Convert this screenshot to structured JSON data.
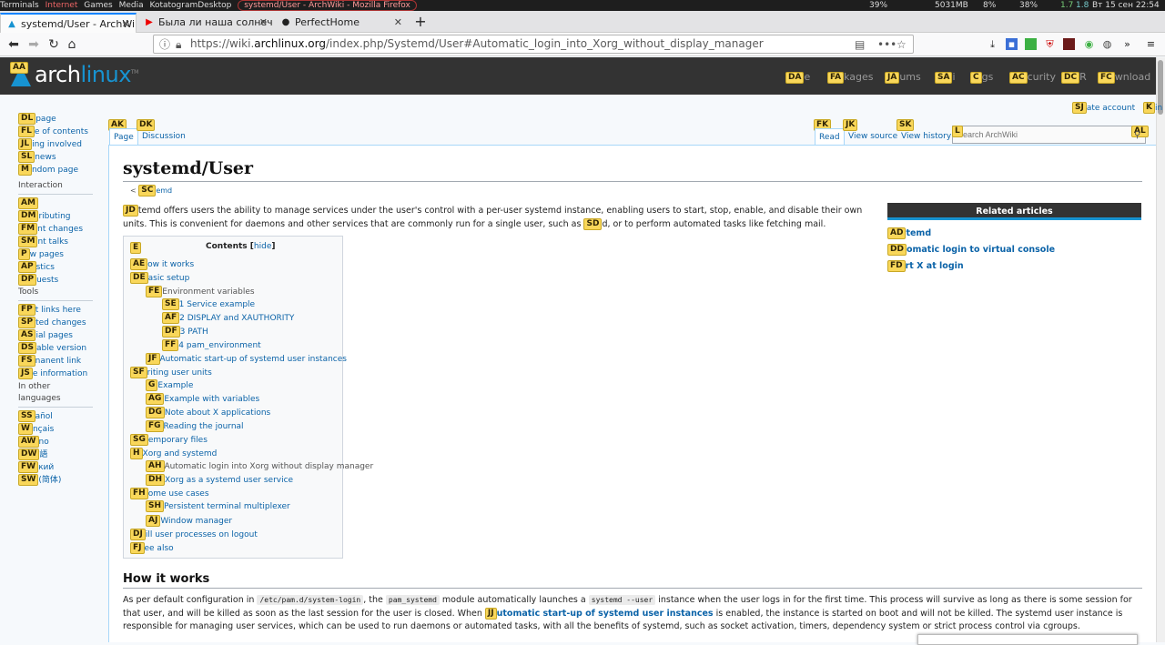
{
  "taskbar": {
    "items": [
      "Terminals",
      "Internet",
      "Games",
      "Media",
      "KotatogramDesktop"
    ],
    "active_window": "systemd/User - ArchWiki - Mozilla Firefox",
    "status": [
      "39%",
      "5031MB",
      "8%",
      "38%",
      "1.7",
      "1.8"
    ],
    "clock": "Вт 15 сен 22:54"
  },
  "browser": {
    "tabs": [
      {
        "label": "systemd/User - ArchWiki",
        "favicon": "arch-icon"
      },
      {
        "label": "Была ли наша солнечная",
        "favicon": "youtube-icon"
      },
      {
        "label": "PerfectHome",
        "favicon": "page-icon"
      }
    ],
    "url_prefix": "https://wiki.",
    "url_domain": "archlinux.org",
    "url_path": "/index.php/Systemd/User#Automatic_login_into_Xorg_without_display_manager",
    "new_tab": "+"
  },
  "site": {
    "logo_arch": "arch",
    "logo_linux": "linux",
    "logo_tm": "TM",
    "logo_hint": "AA",
    "nav": [
      {
        "hint": "DA",
        "label": "e"
      },
      {
        "hint": "FA",
        "label": "kages"
      },
      {
        "hint": "JA",
        "label": "ums"
      },
      {
        "hint": "SA",
        "label": "i"
      },
      {
        "hint": "C",
        "label": "gs"
      },
      {
        "hint": "AC",
        "label": "curity"
      },
      {
        "hint": "DC",
        "label": "R"
      },
      {
        "hint": "FC",
        "label": "wnload"
      }
    ]
  },
  "user_menu": {
    "create_hint": "SJ",
    "create": "ate account",
    "login_hint": "K",
    "login": "in"
  },
  "page_tabs": [
    {
      "hint": "AK",
      "label": "Page"
    },
    {
      "hint": "DK",
      "label": "Discussion"
    },
    {
      "hint": "FK",
      "label": "Read"
    },
    {
      "hint": "JK",
      "label": "View source"
    },
    {
      "hint": "SK",
      "label": "View history"
    }
  ],
  "search": {
    "hint": "L",
    "placeholder": "Search ArchWiki",
    "go_hint": "AL"
  },
  "sidebar": {
    "nav": [
      {
        "hint": "DL",
        "label": "page"
      },
      {
        "hint": "FL",
        "label": "e of contents"
      },
      {
        "hint": "JL",
        "label": "ing involved"
      },
      {
        "hint": "SL",
        "label": "news"
      },
      {
        "hint": "M",
        "label": "ndom page"
      }
    ],
    "interaction_title": "Interaction",
    "interaction": [
      {
        "hint": "AM",
        "label": ""
      },
      {
        "hint": "DM",
        "label": "ributing"
      },
      {
        "hint": "FM",
        "label": "nt changes"
      },
      {
        "hint": "SM",
        "label": "nt talks"
      },
      {
        "hint": "P",
        "label": "w pages"
      },
      {
        "hint": "AP",
        "label": "stics"
      },
      {
        "hint": "DP",
        "label": "uests"
      }
    ],
    "tools_title": "Tools",
    "tools": [
      {
        "hint": "FP",
        "label": "t links here"
      },
      {
        "hint": "SP",
        "label": "ted changes"
      },
      {
        "hint": "AS",
        "label": "ial pages"
      },
      {
        "hint": "DS",
        "label": "able version"
      },
      {
        "hint": "FS",
        "label": "nanent link"
      },
      {
        "hint": "JS",
        "label": "e information"
      }
    ],
    "languages_title": "In other languages",
    "languages": [
      {
        "hint": "SS",
        "label": "añol"
      },
      {
        "hint": "W",
        "label": "nçais"
      },
      {
        "hint": "AW",
        "label": "no"
      },
      {
        "hint": "DW",
        "label": "語"
      },
      {
        "hint": "FW",
        "label": "кий"
      },
      {
        "hint": "SW",
        "label": "(简体)"
      }
    ]
  },
  "article": {
    "title": "systemd/User",
    "crumb_prefix": "<",
    "crumb_hint": "SC",
    "crumb_text": "emd",
    "intro_hint": "JD",
    "intro_1": "temd offers users the ability to manage services under the user's control with a per-user systemd instance, enabling users to start, stop, enable, and disable their own units. This is convenient for daemons and other services that are commonly run for a single user, such as",
    "intro_hint2": "SD",
    "intro_2": "d, or to perform automated tasks like fetching mail.",
    "toc_title": "Contents",
    "toc_hide": "hide",
    "toc_hint": "E",
    "toc": [
      {
        "hint": "AE",
        "label": "ow it works"
      },
      {
        "hint": "DE",
        "label": "asic setup"
      },
      {
        "hint": "FE",
        "label": "Environment variables"
      },
      {
        "hint": "SE",
        "label": "1  Service example"
      },
      {
        "hint": "AF",
        "label": "2  DISPLAY and XAUTHORITY"
      },
      {
        "hint": "DF",
        "label": "3  PATH"
      },
      {
        "hint": "FF",
        "label": "4  pam_environment"
      },
      {
        "hint": "JF",
        "label": "Automatic start-up of systemd user instances"
      },
      {
        "hint": "SF",
        "label": "riting user units"
      },
      {
        "hint": "G",
        "label": "Example"
      },
      {
        "hint": "AG",
        "label": "Example with variables"
      },
      {
        "hint": "DG",
        "label": "Note about X applications"
      },
      {
        "hint": "FG",
        "label": "Reading the journal"
      },
      {
        "hint": "SG",
        "label": "emporary files"
      },
      {
        "hint": "H",
        "label": "Xorg and systemd"
      },
      {
        "hint": "AH",
        "label": "Automatic login into Xorg without display manager"
      },
      {
        "hint": "DH",
        "label": "Xorg as a systemd user service"
      },
      {
        "hint": "FH",
        "label": "ome use cases"
      },
      {
        "hint": "SH",
        "label": "Persistent terminal multiplexer"
      },
      {
        "hint": "AJ",
        "label": "Window manager"
      },
      {
        "hint": "DJ",
        "label": "ill user processes on logout"
      },
      {
        "hint": "FJ",
        "label": "ee also"
      }
    ],
    "related_title": "Related articles",
    "related": [
      {
        "hint": "AD",
        "label": "temd"
      },
      {
        "hint": "DD",
        "label": "omatic login to virtual console"
      },
      {
        "hint": "FD",
        "label": "rt X at login"
      }
    ],
    "section_title": "How it works",
    "para_1": "As per default configuration in",
    "code_1": "/etc/pam.d/system-login",
    "para_2": ", the",
    "code_2": "pam_systemd",
    "para_3": "module automatically launches a",
    "code_3": "systemd --user",
    "para_4": "instance when the user logs in for the first time. This process will survive as long as there is some session for that user, and will be killed as soon as the last session for the user is closed. When",
    "para_hint": "JJ",
    "para_link": "utomatic start-up of systemd user instances",
    "para_5": "is enabled, the instance is started on boot and will not be killed. The systemd user instance is responsible for managing user services, which can be used to run daemons or automated tasks, with all the benefits of systemd, such as socket activation, timers, dependency system or strict process control via cgroups."
  },
  "colors": {
    "hint_bg": "#f9d75a",
    "link": "#0b63a8",
    "header": "#333333",
    "arch_blue": "#1793d1"
  }
}
